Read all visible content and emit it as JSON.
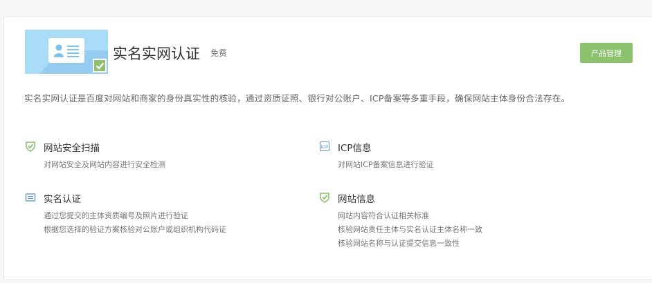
{
  "product": {
    "title": "实名实网认证",
    "tag": "免费",
    "manage_button": "产品管理",
    "description": "实名实网认证是百度对网站和商家的身份真实性的核验，通过资质证照、银行对公账户、ICP备案等多重手段，确保网站主体身份合法存在。"
  },
  "colors": {
    "accent_green": "#8cc26d",
    "hero_blue": "#a9dcf7",
    "icon_blue": "#5b8fc7"
  },
  "features": [
    {
      "icon": "shield-check-icon",
      "name": "网站安全扫描",
      "lines": [
        "对网站安全及网站内容进行安全检测"
      ]
    },
    {
      "icon": "icp-icon",
      "icon_text": "ICP",
      "name": "ICP信息",
      "lines": [
        "对网站ICP备案信息进行验证"
      ]
    },
    {
      "icon": "id-card-icon",
      "name": "实名认证",
      "lines": [
        "通过您提交的主体资质编号及照片进行验证",
        "根据您选择的验证方案核验对公账户或组织机构代码证"
      ]
    },
    {
      "icon": "shield-check-icon",
      "name": "网站信息",
      "lines": [
        "网站内容符合认证相关标准",
        "核验网站责任主体与实名认证主体名称一致",
        "核验网站名称与认证提交信息一致性"
      ]
    }
  ]
}
